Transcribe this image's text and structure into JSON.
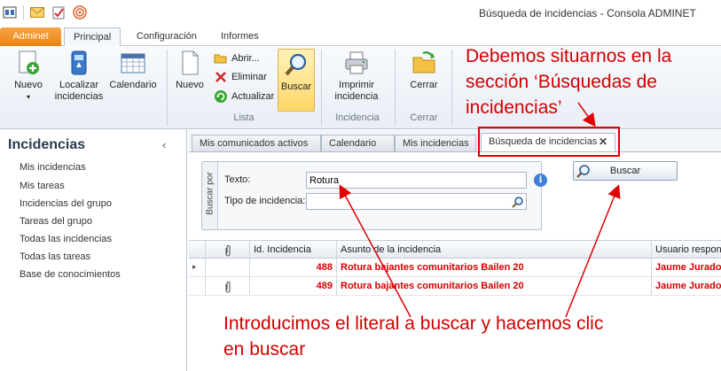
{
  "window": {
    "title": "Búsqueda de incidencias - Consola ADMINET"
  },
  "ribbon_tabs": [
    "Adminet",
    "Principal",
    "Configuración",
    "Informes"
  ],
  "ribbon": {
    "nuevo": "Nuevo",
    "localizar_1": "Localizar",
    "localizar_2": "incidencias",
    "calendario": "Calendario",
    "nuevo2": "Nuevo",
    "abrir": "Abrir...",
    "eliminar": "Eliminar",
    "actualizar": "Actualizar",
    "buscar": "Buscar",
    "lista_label": "Lista",
    "imprimir_1": "Imprimir",
    "imprimir_2": "incidencia",
    "incidencia_label": "Incidencia",
    "cerrar": "Cerrar",
    "cerrar_label": "Cerrar"
  },
  "sidebar": {
    "title": "Incidencias",
    "collapse": "‹",
    "items": [
      "Mis incidencias",
      "Mis tareas",
      "Incidencias del grupo",
      "Tareas del grupo",
      "Todas las incidencias",
      "Todas las tareas",
      "Base de conocimientos"
    ]
  },
  "doc_tabs": [
    "Mis comunicados activos",
    "Calendario",
    "Mis incidencias",
    "Búsqueda de incidencias"
  ],
  "doc_tab_close": "✕",
  "search": {
    "group_label": "Buscar por",
    "texto_label": "Texto:",
    "texto_value": "Rotura",
    "tipo_label": "Tipo de incidencia:",
    "tipo_value": "",
    "button": "Buscar"
  },
  "grid": {
    "columns": [
      "",
      "",
      "Id. Incidencia",
      "Asunto de la incidencia",
      "Usuario respons"
    ],
    "rows": [
      {
        "marker": "▸",
        "attach": "",
        "id": "488",
        "asunto": "Rotura bajantes comunitarios Bailen 20",
        "usuario": "Jaume Jurado"
      },
      {
        "marker": "",
        "attach": "attach",
        "id": "489",
        "asunto": "Rotura bajantes comunitarios Bailen 20",
        "usuario": "Jaume Jurado"
      }
    ]
  },
  "annotations": {
    "top_1": "Debemos situarnos en la",
    "top_2": "sección ‘Búsquedas de",
    "top_3": "incidencias’",
    "bottom_1": "Introducimos el literal a buscar y hacemos clic",
    "bottom_2": "en buscar",
    "color": "#d10000"
  },
  "colors": {
    "accent_orange": "#e9830e",
    "selected_button": "#ffd76a",
    "row_text": "#d40000"
  }
}
